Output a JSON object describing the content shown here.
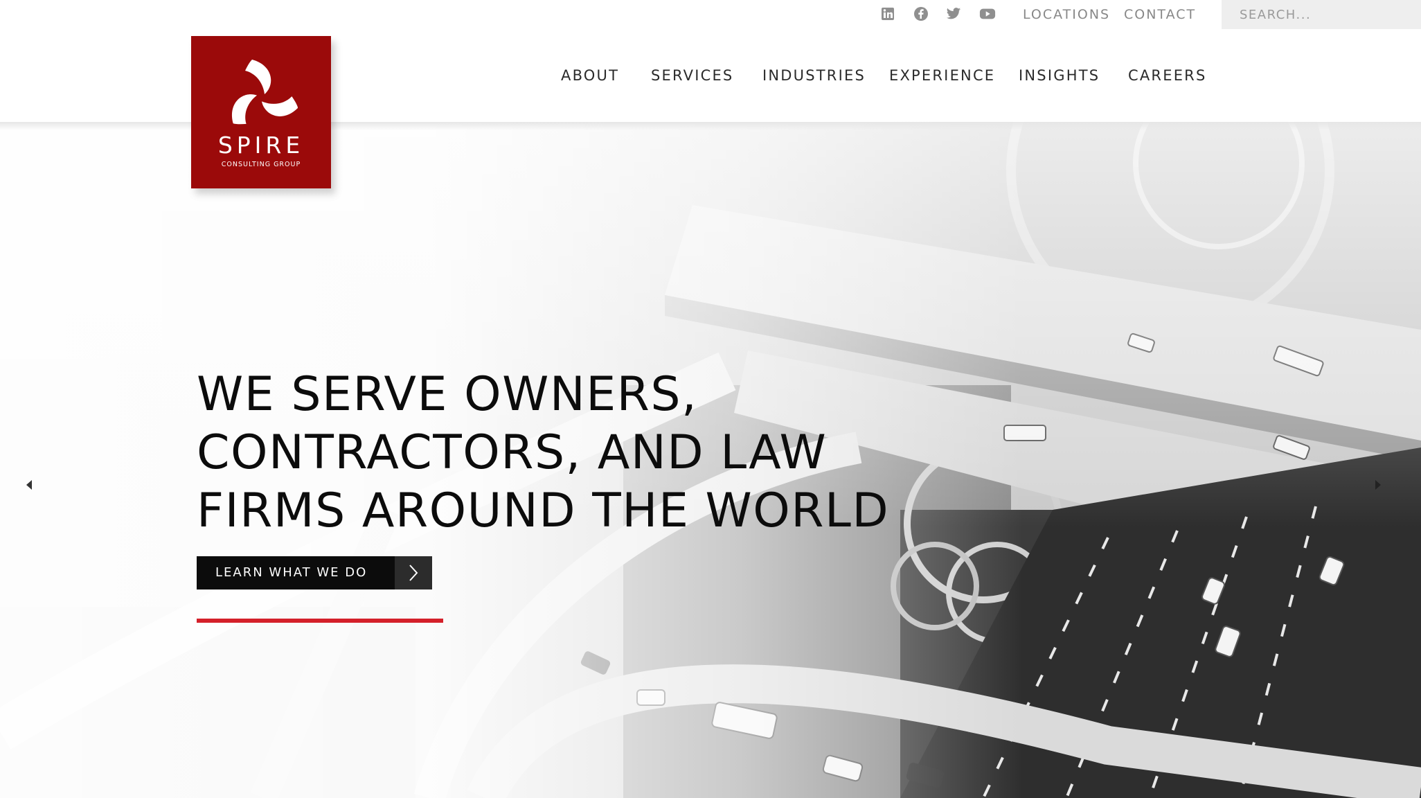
{
  "brand": {
    "name": "SPIRE",
    "tagline": "CONSULTING GROUP",
    "primary_color": "#9b0a0a",
    "accent_color": "#d4202a"
  },
  "utility_bar": {
    "social": [
      {
        "icon": "linkedin-icon"
      },
      {
        "icon": "facebook-icon"
      },
      {
        "icon": "twitter-icon"
      },
      {
        "icon": "youtube-icon"
      }
    ],
    "links": [
      "LOCATIONS",
      "CONTACT"
    ],
    "search_placeholder": "SEARCH..."
  },
  "nav": {
    "items": [
      "ABOUT",
      "SERVICES",
      "INDUSTRIES",
      "EXPERIENCE",
      "INSIGHTS",
      "CAREERS"
    ]
  },
  "hero": {
    "headline_lines": [
      "WE SERVE OWNERS,",
      "CONTRACTORS, AND LAW",
      "FIRMS AROUND THE WORLD"
    ],
    "cta_label": "LEARN WHAT WE DO",
    "cta_icon": "chevron-right-icon",
    "prev_icon": "caret-left-icon",
    "next_icon": "caret-right-icon"
  }
}
